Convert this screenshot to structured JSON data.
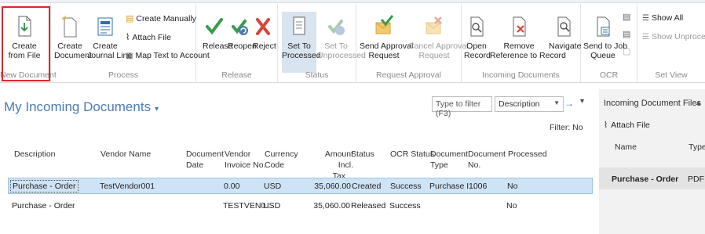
{
  "ribbon": {
    "new_document": {
      "label": "New Document",
      "create_from_file": [
        "Create",
        "from File"
      ]
    },
    "process": {
      "label": "Process",
      "create_document": [
        "Create",
        "Document"
      ],
      "create_journal_line": [
        "Create",
        "Journal Line"
      ],
      "create_manually": "Create Manually",
      "attach_file": "Attach File",
      "map_text_to_account": "Map Text to Account"
    },
    "release": {
      "label": "Release",
      "release": "Release",
      "reopen": "Reopen",
      "reject": "Reject"
    },
    "status": {
      "label": "Status",
      "set_to_processed": [
        "Set To",
        "Processed"
      ],
      "set_to_unprocessed": [
        "Set To",
        "Unprocessed"
      ]
    },
    "request_approval": {
      "label": "Request Approval",
      "send_approval_request": [
        "Send Approval",
        "Request"
      ],
      "cancel_approval_request": [
        "Cancel Approval",
        "Request"
      ]
    },
    "incoming_documents": {
      "label": "Incoming Documents",
      "open_record": [
        "Open",
        "Record"
      ],
      "remove_reference": [
        "Remove",
        "Reference to Record"
      ],
      "navigate": "Navigate"
    },
    "ocr": {
      "label": "OCR",
      "send_to_job_queue": [
        "Send to Job",
        "Queue"
      ]
    },
    "set_view": {
      "label": "Set View",
      "show_all": "Show All",
      "show_unprocessed": "Show Unprocessed"
    }
  },
  "page": {
    "title": "My Incoming Documents",
    "filter_placeholder": "Type to filter (F3)",
    "filter_field": "Description",
    "filter_status": "Filter: No"
  },
  "table": {
    "headers": {
      "description": "Description",
      "vendor_name": "Vendor Name",
      "document_date": [
        "Document",
        "Date"
      ],
      "vendor_invoice_no": [
        "Vendor",
        "Invoice No."
      ],
      "currency_code": [
        "Currency",
        "Code"
      ],
      "amount_incl_tax": [
        "Amount Incl.",
        "Tax"
      ],
      "status": "Status",
      "ocr_status": "OCR Status",
      "document_type": [
        "Document",
        "Type"
      ],
      "document_no": [
        "Document",
        "No."
      ],
      "processed": "Processed"
    },
    "rows": [
      {
        "description": "Purchase - Order",
        "vendor_name": "TestVendor001",
        "document_date": "",
        "vendor_invoice_no": "0.00",
        "currency_code": "USD",
        "amount_incl_tax": "35,060.00",
        "status": "Created",
        "ocr_status": "Success",
        "document_type": "Purchase I...",
        "document_no": "1006",
        "processed": "No"
      },
      {
        "description": "Purchase - Order",
        "vendor_name": "",
        "document_date": "",
        "vendor_invoice_no": "TESTVEN0...",
        "currency_code": "USD",
        "amount_incl_tax": "35,060.00",
        "status": "Released",
        "ocr_status": "Success",
        "document_type": "",
        "document_no": "",
        "processed": "No"
      }
    ]
  },
  "factbox": {
    "title": "Incoming Document Files",
    "attach_file": "Attach File",
    "headers": {
      "name": "Name",
      "type": "Type"
    },
    "rows": [
      {
        "name": "Purchase - Order",
        "type": "PDF"
      }
    ]
  },
  "colors": {
    "accent": "#4b7ab4",
    "highlight_box": "#e0262b",
    "selected_row": "#cfe3f6",
    "check_green": "#3a9a4e",
    "reject_red": "#d9453a"
  }
}
